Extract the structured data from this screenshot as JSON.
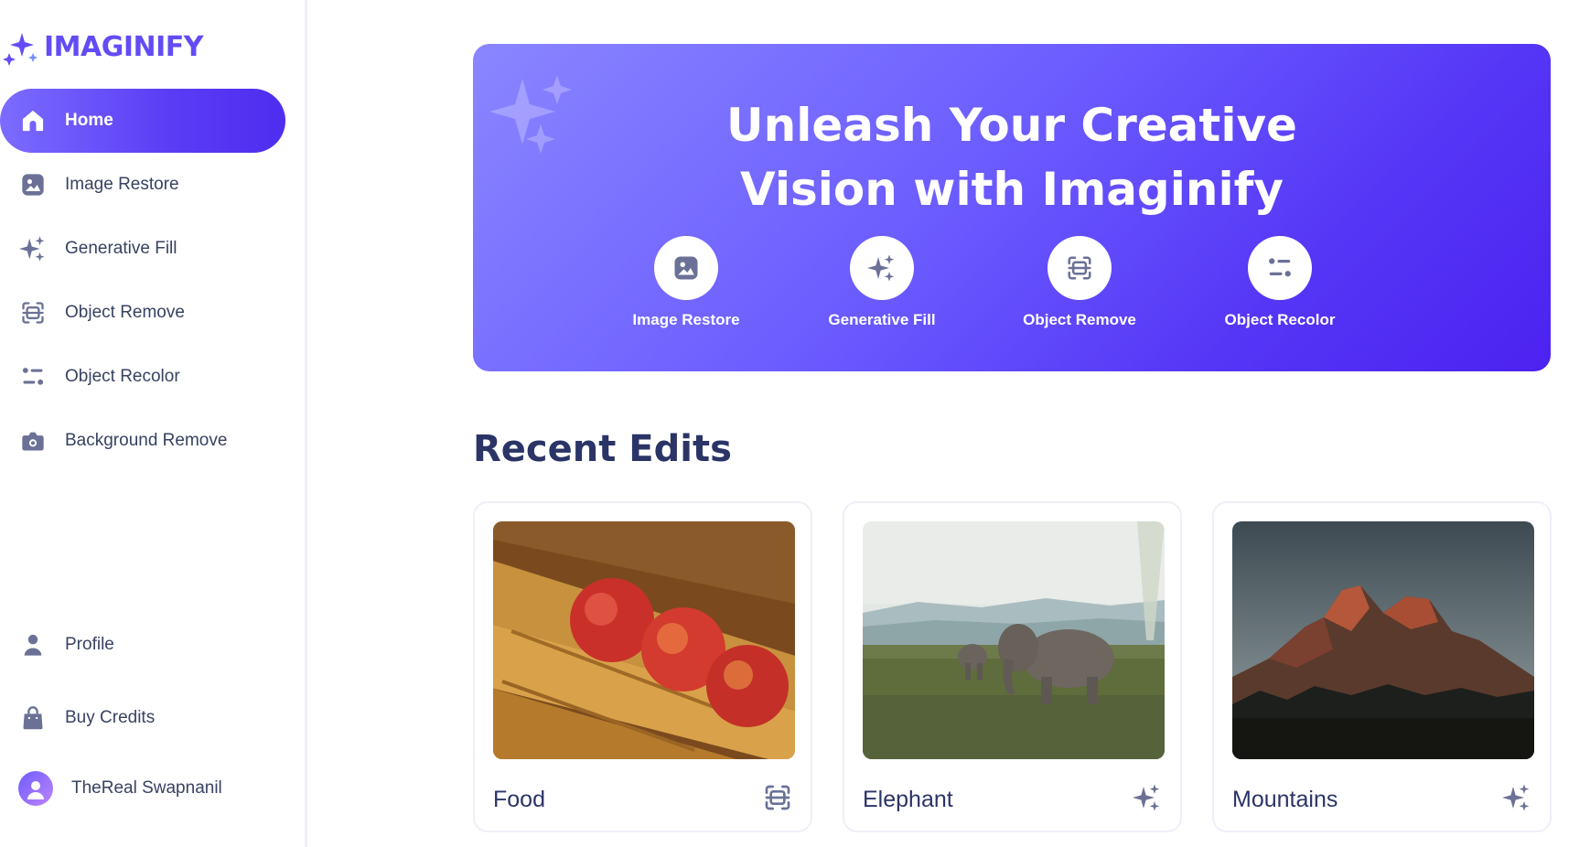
{
  "brand": {
    "name": "IMAGINIFY"
  },
  "sidebar": {
    "items": [
      {
        "label": "Home",
        "icon": "home-icon",
        "active": true
      },
      {
        "label": "Image Restore",
        "icon": "image-icon"
      },
      {
        "label": "Generative Fill",
        "icon": "stars-icon"
      },
      {
        "label": "Object Remove",
        "icon": "scan-icon"
      },
      {
        "label": "Object Recolor",
        "icon": "filter-icon"
      },
      {
        "label": "Background Remove",
        "icon": "camera-icon"
      }
    ],
    "bottom_items": [
      {
        "label": "Profile",
        "icon": "user-icon"
      },
      {
        "label": "Buy Credits",
        "icon": "bag-icon"
      }
    ],
    "user": {
      "name": "TheReal Swapnanil"
    }
  },
  "hero": {
    "title_line1": "Unleash Your Creative",
    "title_line2": "Vision with Imaginify",
    "tools": [
      {
        "label": "Image Restore",
        "icon": "image-icon"
      },
      {
        "label": "Generative Fill",
        "icon": "stars-icon"
      },
      {
        "label": "Object Remove",
        "icon": "scan-icon"
      },
      {
        "label": "Object Recolor",
        "icon": "filter-icon"
      }
    ]
  },
  "recent": {
    "title": "Recent Edits",
    "cards": [
      {
        "title": "Food",
        "icon": "scan-icon"
      },
      {
        "title": "Elephant",
        "icon": "stars-icon"
      },
      {
        "title": "Mountains",
        "icon": "stars-icon"
      }
    ]
  },
  "colors": {
    "accent": "#624cf5",
    "hero_start": "#8a86ff",
    "hero_end": "#4c22f0",
    "text_dark": "#2b3467",
    "icon_gray": "#6b7196"
  }
}
